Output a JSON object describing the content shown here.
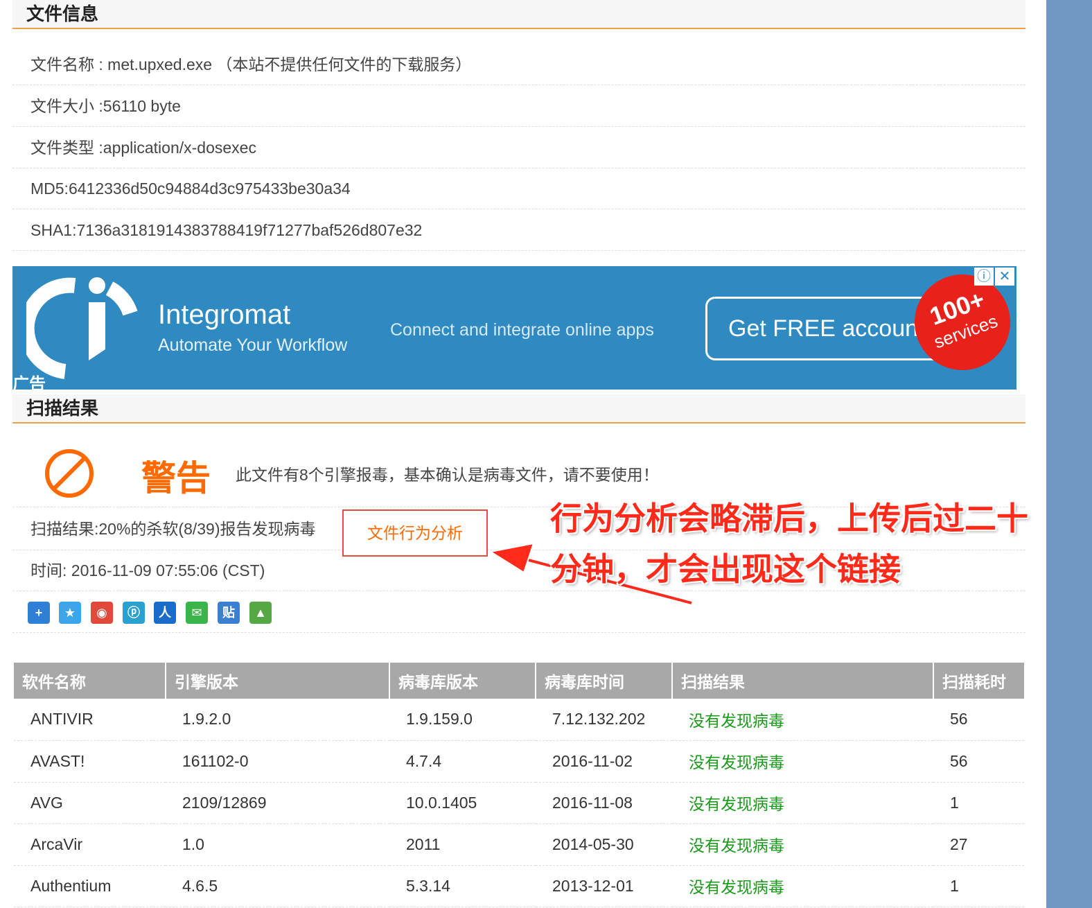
{
  "file_info": {
    "header": "文件信息",
    "rows": [
      "文件名称 : met.upxed.exe （本站不提供任何文件的下载服务）",
      "文件大小 :56110 byte",
      "文件类型 :application/x-dosexec",
      "MD5:6412336d50c94884d3c975433be30a34",
      "SHA1:7136a3181914383788419f71277baf526d807e32"
    ]
  },
  "ad": {
    "brand": "Integromat",
    "tagline": "Automate Your Workflow",
    "middle_text": "Connect and integrate online apps",
    "cta": "Get FREE account",
    "badge_line1": "100+",
    "badge_line2": "services",
    "info_icon": "ⓘ",
    "close_icon": "✕",
    "label": "广告",
    "colors": {
      "background": "#2e8ac1",
      "badge": "#e8211b"
    }
  },
  "scan": {
    "header": "扫描结果",
    "warning_title": "警告",
    "warning_text": "此文件有8个引擎报毒，基本确认是病毒文件，请不要使用！",
    "result_text": "扫描结果:20%的杀软(8/39)报告发现病毒",
    "behavior_button": "文件行为分析",
    "time_text": "时间: 2016-11-09 07:55:06 (CST)",
    "share_icons": [
      "plus-share-icon",
      "qzone-icon",
      "weibo-icon",
      "tencent-weibo-icon",
      "renren-icon",
      "wechat-icon",
      "tieba-icon",
      "douban-icon"
    ],
    "share_glyphs": [
      "+",
      "★",
      "◉",
      "ⓟ",
      "人",
      "✉",
      "贴",
      "▲"
    ],
    "share_colors": [
      "#2f7fd6",
      "#3ea5e8",
      "#e04a3a",
      "#2aa0d0",
      "#1a6cc8",
      "#3bb54a",
      "#3a7fd0",
      "#56a845"
    ]
  },
  "annotation": {
    "line1": "行为分析会略滞后，上传后过二十",
    "line2": "分钟，才会出现这个链接",
    "color": "#ff2a1a"
  },
  "table": {
    "columns": [
      "软件名称",
      "引擎版本",
      "病毒库版本",
      "病毒库时间",
      "扫描结果",
      "扫描耗时"
    ],
    "rows": [
      [
        "ANTIVIR",
        "1.9.2.0",
        "1.9.159.0",
        "7.12.132.202",
        "没有发现病毒",
        "56"
      ],
      [
        "AVAST!",
        "161102-0",
        "4.7.4",
        "2016-11-02",
        "没有发现病毒",
        "56"
      ],
      [
        "AVG",
        "2109/12869",
        "10.0.1405",
        "2016-11-08",
        "没有发现病毒",
        "1"
      ],
      [
        "ArcaVir",
        "1.0",
        "2011",
        "2014-05-30",
        "没有发现病毒",
        "27"
      ],
      [
        "Authentium",
        "4.6.5",
        "5.3.14",
        "2013-12-01",
        "没有发现病毒",
        "1"
      ]
    ]
  }
}
